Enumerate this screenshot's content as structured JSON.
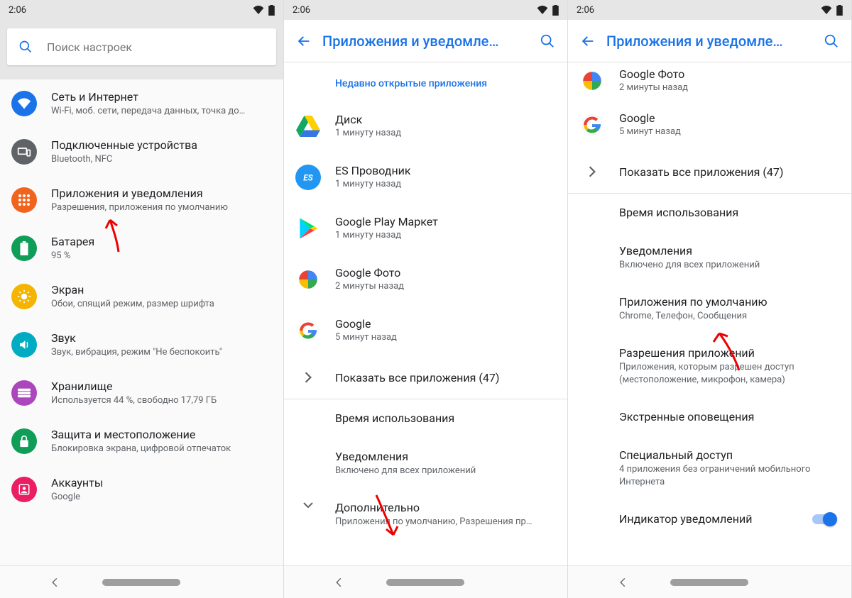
{
  "status": {
    "time": "2:06"
  },
  "phone1": {
    "search_placeholder": "Поиск настроек",
    "items": [
      {
        "title": "Сеть и Интернет",
        "sub": "Wi-Fi, моб. сети, передача данных, точка до…"
      },
      {
        "title": "Подключенные устройства",
        "sub": "Bluetooth, NFC"
      },
      {
        "title": "Приложения и уведомления",
        "sub": "Разрешения, приложения по умолчанию"
      },
      {
        "title": "Батарея",
        "sub": "95 %"
      },
      {
        "title": "Экран",
        "sub": "Обои, спящий режим, размер шрифта"
      },
      {
        "title": "Звук",
        "sub": "Звук, вибрация, режим \"Не беспокоить\""
      },
      {
        "title": "Хранилище",
        "sub": "Используется 44 %, свободно 17,79 ГБ"
      },
      {
        "title": "Защита и местоположение",
        "sub": "Блокировка экрана, цифровой отпечаток"
      },
      {
        "title": "Аккаунты",
        "sub": "Google"
      }
    ]
  },
  "phone2": {
    "title": "Приложения и уведомле…",
    "recent_header": "Недавно открытые приложения",
    "apps": [
      {
        "name": "Диск",
        "sub": "1 минуту назад"
      },
      {
        "name": "ES Проводник",
        "sub": "1 минуту назад"
      },
      {
        "name": "Google Play Маркет",
        "sub": "1 минуту назад"
      },
      {
        "name": "Google Фото",
        "sub": "2 минуты назад"
      },
      {
        "name": "Google",
        "sub": "5 минут назад"
      }
    ],
    "show_all": "Показать все приложения (47)",
    "usage": "Время использования",
    "notifications": {
      "title": "Уведомления",
      "sub": "Включено для всех приложений"
    },
    "more": {
      "title": "Дополнительно",
      "sub": "Приложения по умолчанию, Разрешения пр…"
    }
  },
  "phone3": {
    "title": "Приложения и уведомле…",
    "apps": [
      {
        "name": "Google Фото",
        "sub": "2 минуты назад"
      },
      {
        "name": "Google",
        "sub": "5 минут назад"
      }
    ],
    "show_all": "Показать все приложения (47)",
    "usage": "Время использования",
    "notifications": {
      "title": "Уведомления",
      "sub": "Включено для всех приложений"
    },
    "default_apps": {
      "title": "Приложения по умолчанию",
      "sub": "Chrome, Телефон, Сообщения"
    },
    "permissions": {
      "title": "Разрешения приложений",
      "sub": "Приложения, которым разрешен доступ (местоположение, микрофон, камера)"
    },
    "emergency": "Экстренные оповещения",
    "special": {
      "title": "Специальный доступ",
      "sub": "4 приложения без ограничений мобильного Интернета"
    },
    "indicator": "Индикатор уведомлений"
  }
}
